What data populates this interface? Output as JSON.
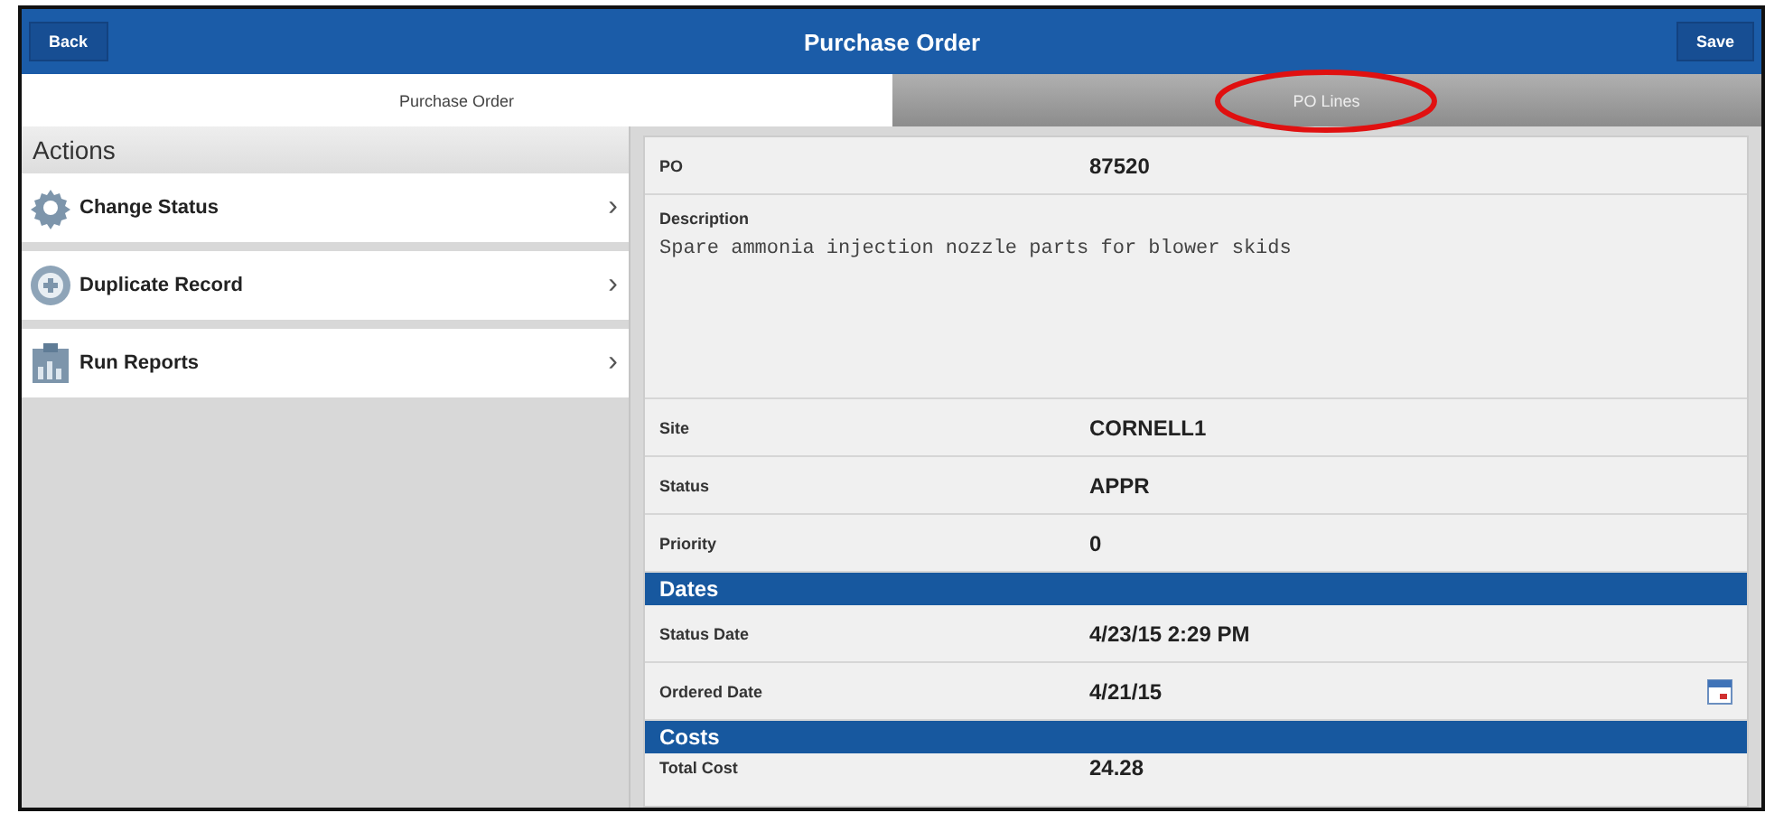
{
  "header": {
    "back": "Back",
    "title": "Purchase Order",
    "save": "Save"
  },
  "tabs": [
    {
      "label": "Purchase Order",
      "selected": true,
      "circled": false
    },
    {
      "label": "PO Lines",
      "selected": false,
      "circled": true
    }
  ],
  "actions": {
    "title": "Actions",
    "items": [
      {
        "label": "Change Status",
        "kind": "gear",
        "arrow": "›"
      },
      {
        "label": "Duplicate Record",
        "kind": "plus",
        "arrow": "›"
      },
      {
        "label": "Run Reports",
        "kind": "report",
        "arrow": "›"
      }
    ]
  },
  "fields": [
    {
      "kind": "text",
      "label": "PO",
      "value": "87520"
    },
    {
      "kind": "textarea",
      "label": "Description",
      "value": "Spare ammonia injection nozzle parts for blower skids"
    },
    {
      "kind": "text",
      "label": "Site",
      "value": "CORNELL1"
    },
    {
      "kind": "text",
      "label": "Status",
      "value": "APPR"
    },
    {
      "kind": "text",
      "label": "Priority",
      "value": "0"
    },
    {
      "kind": "section",
      "label": "Dates"
    },
    {
      "kind": "text",
      "label": "Status Date",
      "value": "4/23/15 2:29 PM"
    },
    {
      "kind": "date",
      "label": "Ordered Date",
      "value": "4/21/15"
    },
    {
      "kind": "section",
      "label": "Costs"
    },
    {
      "kind": "last",
      "label": "Total Cost",
      "value": "24.28"
    }
  ]
}
